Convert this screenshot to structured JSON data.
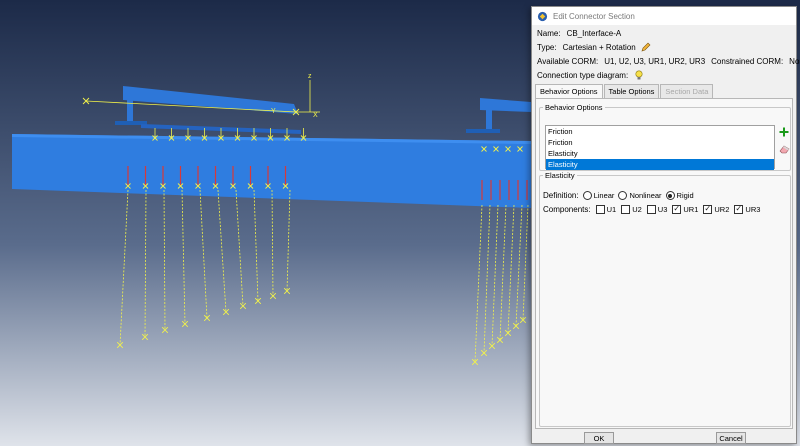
{
  "dialog": {
    "title": "Edit Connector Section",
    "name_label": "Name:",
    "name_value": "CB_Interface-A",
    "type_label": "Type:",
    "type_value": "Cartesian + Rotation",
    "available_corm_label": "Available CORM:",
    "available_corm_value": "U1, U2, U3, UR1, UR2, UR3",
    "constrained_corm_label": "Constrained CORM:",
    "constrained_corm_value": "None",
    "connection_diagram_label": "Connection type diagram:",
    "tabs": [
      {
        "label": "Behavior Options",
        "active": true
      },
      {
        "label": "Table Options",
        "active": false
      },
      {
        "label": "Section Data",
        "disabled": true
      }
    ],
    "behavior_group_label": "Behavior Options",
    "behavior_items": [
      "Friction",
      "Friction",
      "Elasticity",
      "Elasticity"
    ],
    "elasticity_group_label": "Elasticity",
    "definition_label": "Definition:",
    "definition_options": [
      "Linear",
      "Nonlinear",
      "Rigid"
    ],
    "definition_selected": "Rigid",
    "components_label": "Components:",
    "components": [
      {
        "label": "U1",
        "checked": false
      },
      {
        "label": "U2",
        "checked": false
      },
      {
        "label": "U3",
        "checked": false
      },
      {
        "label": "UR1",
        "checked": true
      },
      {
        "label": "UR2",
        "checked": true
      },
      {
        "label": "UR3",
        "checked": true
      }
    ],
    "ok_label": "OK",
    "cancel_label": "Cancel"
  },
  "viewport": {
    "axis_labels": [
      "z",
      "Y",
      "X"
    ],
    "colors": {
      "background_top": "#1c2a48",
      "background_bottom": "#dfe3ea",
      "slab": "#2f7de0",
      "rail": "#2e77d8",
      "connector": "#f2f24a",
      "load": "#d83838"
    }
  },
  "icons": {
    "app": "abaqus-icon",
    "edit": "pencil-icon",
    "diagram": "lightbulb-icon",
    "add": "plus-icon",
    "delete": "eraser-icon"
  }
}
